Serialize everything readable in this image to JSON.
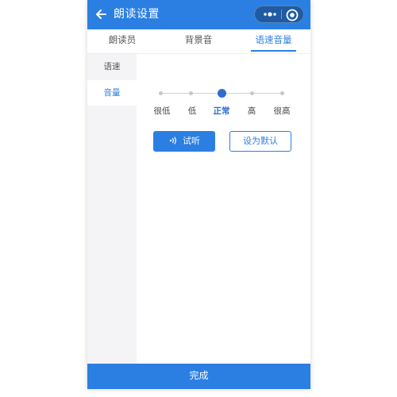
{
  "header": {
    "title": "朗读设置",
    "back_icon": "back-arrow-icon",
    "more_icon": "more-dots-icon",
    "close_icon": "target-close-icon"
  },
  "tabs": [
    {
      "label": "朗读员",
      "active": false
    },
    {
      "label": "背景音",
      "active": false
    },
    {
      "label": "语速音量",
      "active": true
    }
  ],
  "sidebar": {
    "items": [
      {
        "label": "语速",
        "active": false
      },
      {
        "label": "音量",
        "active": true
      }
    ]
  },
  "speed": {
    "options": [
      "很低",
      "低",
      "正常",
      "高",
      "很高"
    ],
    "selected_index": 2
  },
  "buttons": {
    "preview_label": "试听",
    "preview_icon": "sound-wave-icon",
    "default_label": "设为默认"
  },
  "footer": {
    "done_label": "完成"
  },
  "colors": {
    "accent": "#2b7fe2",
    "thumb": "#2b6fd0",
    "sidebar_bg": "#f4f4f6"
  }
}
